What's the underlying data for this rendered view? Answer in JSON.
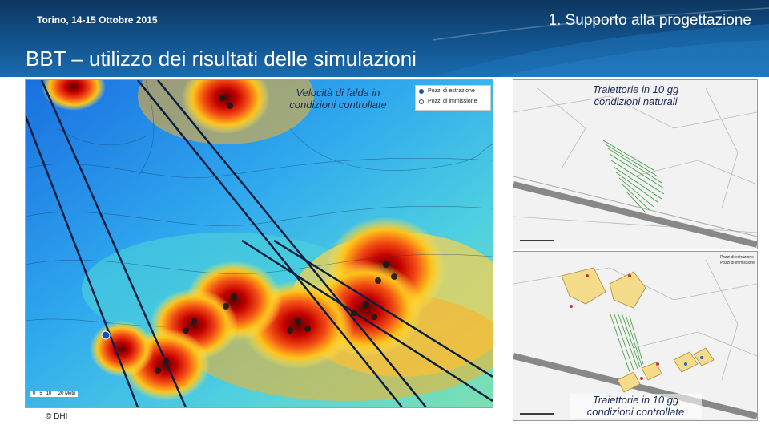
{
  "header": {
    "date": "Torino, 14-15 Ottobre 2015",
    "section_number": "1.",
    "section_title": "Supporto alla progettazione",
    "title": "BBT – utilizzo dei risultati delle simulazioni"
  },
  "left_map": {
    "caption_line1": "Velocità di falda in",
    "caption_line2": "condizioni controllate",
    "legend": [
      {
        "label": "Pozzi di estrazione",
        "icon": "filled-dot",
        "color": "#1e4fb0"
      },
      {
        "label": "Pozzi di immissione",
        "icon": "ring-dot",
        "color": "#444444"
      }
    ],
    "scale": [
      "0",
      "5",
      "10",
      "20 Metri"
    ]
  },
  "right_top_map": {
    "caption_line1": "Traiettorie in 10 gg",
    "caption_line2": "condizioni naturali"
  },
  "right_bottom_map": {
    "caption_line1": "Traiettorie in 10 gg",
    "caption_line2": "condizioni controllate",
    "legend": [
      "Pozzi di estrazione",
      "Pozzi di immissione"
    ]
  },
  "footer": {
    "copyright": "© DHI"
  },
  "colors": {
    "header_dark": "#0c3660",
    "header_light": "#1a6bb0",
    "caption_text": "#1a2a55"
  }
}
